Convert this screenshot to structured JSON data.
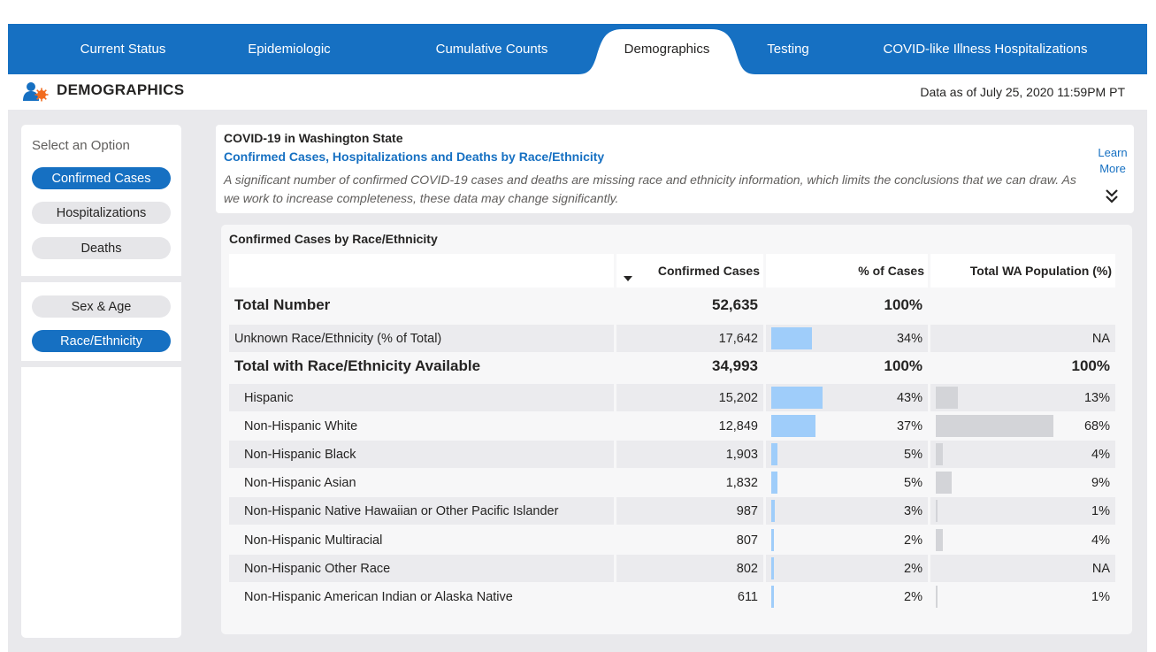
{
  "nav": {
    "tabs": [
      {
        "label": "Current Status",
        "active": false
      },
      {
        "label": "Epidemiologic",
        "active": false
      },
      {
        "label": "Cumulative Counts",
        "active": false
      },
      {
        "label": "Demographics",
        "active": true
      },
      {
        "label": "Testing",
        "active": false
      },
      {
        "label": "COVID-like Illness Hospitalizations",
        "active": false
      }
    ]
  },
  "header": {
    "icon": "people-virus-icon",
    "title": "DEMOGRAPHICS",
    "date": "Data as of July 25, 2020 11:59PM PT"
  },
  "sidebar": {
    "label": "Select an Option",
    "measures": [
      {
        "label": "Confirmed Cases",
        "selected": true
      },
      {
        "label": "Hospitalizations",
        "selected": false
      },
      {
        "label": "Deaths",
        "selected": false
      }
    ],
    "breakdowns": [
      {
        "label": "Sex & Age",
        "selected": false
      },
      {
        "label": "Race/Ethnicity",
        "selected": true
      }
    ]
  },
  "info": {
    "line1": "COVID-19 in Washington State",
    "line2": "Confirmed Cases, Hospitalizations and Deaths by Race/Ethnicity",
    "description": "A significant number of confirmed COVID-19 cases and deaths are missing race and ethnicity information, which limits the conclusions that we can draw. As we work to increase completeness, these data may change significantly.",
    "learn_line1": "Learn",
    "learn_line2": "More",
    "learn_icon": "double-chevron-down-icon"
  },
  "table": {
    "title": "Confirmed Cases by Race/Ethnicity",
    "columns": [
      "",
      "Confirmed Cases",
      "% of Cases",
      "Total WA Population (%)"
    ],
    "sort_icon": "sort-descending-icon",
    "rows": [
      {
        "label": "Total Number",
        "cases": "52,635",
        "pct": "100%",
        "pop": "",
        "bold": true,
        "shade": false,
        "pct_bar": null,
        "pop_bar": null
      },
      {
        "label": "Unknown Race/Ethnicity (% of Total)",
        "cases": "17,642",
        "pct": "34%",
        "pop": "NA",
        "bold": false,
        "shade": true,
        "pct_bar": 34,
        "pop_bar": null
      },
      {
        "label": "Total with Race/Ethnicity Available",
        "cases": "34,993",
        "pct": "100%",
        "pop": "100%",
        "bold": true,
        "shade": false,
        "pct_bar": null,
        "pop_bar": null
      },
      {
        "label": "Hispanic",
        "cases": "15,202",
        "pct": "43%",
        "pop": "13%",
        "bold": false,
        "shade": true,
        "pct_bar": 43,
        "pop_bar": 13
      },
      {
        "label": "Non-Hispanic White",
        "cases": "12,849",
        "pct": "37%",
        "pop": "68%",
        "bold": false,
        "shade": false,
        "pct_bar": 37,
        "pop_bar": 68
      },
      {
        "label": "Non-Hispanic Black",
        "cases": "1,903",
        "pct": "5%",
        "pop": "4%",
        "bold": false,
        "shade": true,
        "pct_bar": 5,
        "pop_bar": 4
      },
      {
        "label": "Non-Hispanic Asian",
        "cases": "1,832",
        "pct": "5%",
        "pop": "9%",
        "bold": false,
        "shade": false,
        "pct_bar": 5,
        "pop_bar": 9
      },
      {
        "label": "Non-Hispanic Native Hawaiian or Other Pacific Islander",
        "cases": "987",
        "pct": "3%",
        "pop": "1%",
        "bold": false,
        "shade": true,
        "pct_bar": 3,
        "pop_bar": 1
      },
      {
        "label": "Non-Hispanic Multiracial",
        "cases": "807",
        "pct": "2%",
        "pop": "4%",
        "bold": false,
        "shade": false,
        "pct_bar": 2,
        "pop_bar": 4
      },
      {
        "label": "Non-Hispanic Other Race",
        "cases": "802",
        "pct": "2%",
        "pop": "NA",
        "bold": false,
        "shade": true,
        "pct_bar": 2,
        "pop_bar": null
      },
      {
        "label": "Non-Hispanic American Indian or Alaska Native",
        "cases": "611",
        "pct": "2%",
        "pop": "1%",
        "bold": false,
        "shade": false,
        "pct_bar": 2,
        "pop_bar": 1
      }
    ]
  },
  "colors": {
    "nav_blue": "#1670c2",
    "pill_selected": "#1670c2",
    "case_bar": "#9fcdfa",
    "population_bar": "#d3d4d8",
    "icon_orange": "#f26b1d"
  }
}
